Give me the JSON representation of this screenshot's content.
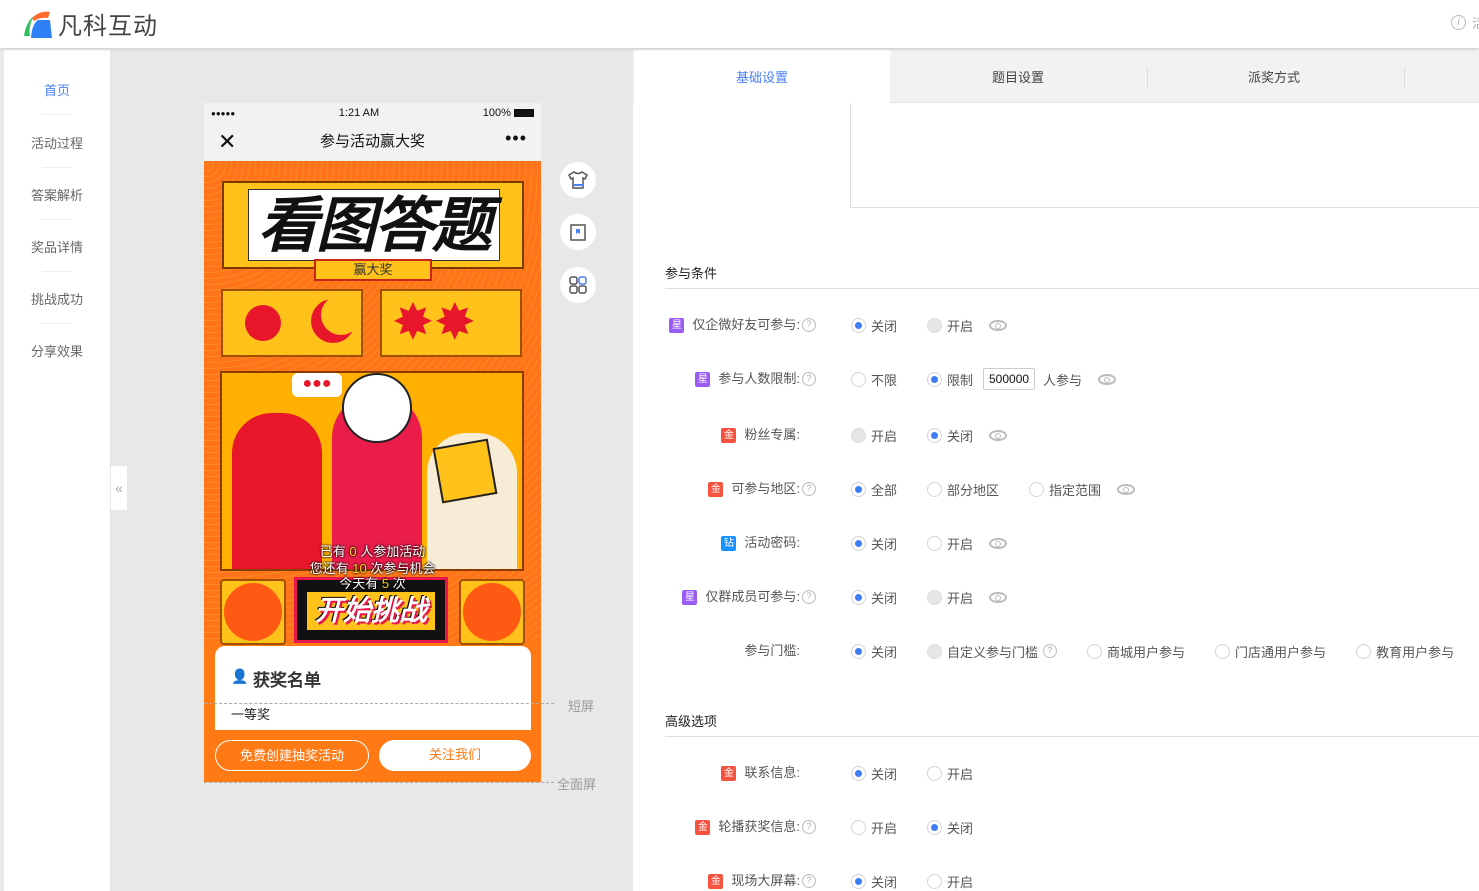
{
  "header": {
    "brand": "凡科互动",
    "right_text": "活"
  },
  "sidebar": {
    "items": [
      {
        "label": "首页",
        "active": true
      },
      {
        "label": "活动过程"
      },
      {
        "label": "答案解析"
      },
      {
        "label": "奖品详情"
      },
      {
        "label": "挑战成功"
      },
      {
        "label": "分享效果"
      }
    ]
  },
  "collapse_label": "«",
  "phone": {
    "status": {
      "signal": "●●●●●",
      "time": "1:21 AM",
      "battery": "100%"
    },
    "nav_title": "参与活动赢大奖",
    "close": "✕",
    "more": "•••",
    "poster_title": "看图答题",
    "poster_ribbon": "赢大奖",
    "stats": {
      "l1a": "已有",
      "l1n": "0",
      "l1b": "人参加活动",
      "l2a": "您还有",
      "l2n": "10",
      "l2b": "次参与机会",
      "l3a": "今天有",
      "l3n": "5",
      "l3b": "次"
    },
    "start_button": "开始挑战",
    "winners_title": "获奖名单",
    "winners_prize": "一等奖",
    "create_button": "免费创建抽奖活动",
    "follow_button": "关注我们"
  },
  "screen_labels": {
    "short": "短屏",
    "full": "全面屏"
  },
  "tabs": [
    {
      "label": "基础设置",
      "active": true
    },
    {
      "label": "题目设置"
    },
    {
      "label": "派奖方式"
    }
  ],
  "sections": {
    "conditions": "参与条件",
    "advanced": "高级选项"
  },
  "badge_colors": {
    "星": "#9b5cf6",
    "金": "#f5533d",
    "钻": "#1890ff"
  },
  "rows": [
    {
      "badge": "星",
      "label": "仅企微好友可参与:",
      "help": true,
      "options": [
        {
          "label": "关闭",
          "state": "on"
        },
        {
          "label": "开启",
          "state": "dis"
        }
      ],
      "eye": true
    },
    {
      "badge": "星",
      "label": "参与人数限制:",
      "help": true,
      "options": [
        {
          "label": "不限",
          "state": "off"
        },
        {
          "label": "限制",
          "state": "on"
        }
      ],
      "input": "500000",
      "suffix": "人参与",
      "eye": true
    },
    {
      "badge": "金",
      "label": "粉丝专属:",
      "help": false,
      "options": [
        {
          "label": "开启",
          "state": "dis"
        },
        {
          "label": "关闭",
          "state": "on"
        }
      ],
      "eye": true
    },
    {
      "badge": "金",
      "label": "可参与地区:",
      "help": true,
      "options": [
        {
          "label": "全部",
          "state": "on"
        },
        {
          "label": "部分地区",
          "state": "off"
        },
        {
          "label": "指定范围",
          "state": "off"
        }
      ],
      "eye": true
    },
    {
      "badge": "钻",
      "label": "活动密码:",
      "help": false,
      "options": [
        {
          "label": "关闭",
          "state": "on"
        },
        {
          "label": "开启",
          "state": "off"
        }
      ],
      "eye": true
    },
    {
      "badge": "星",
      "label": "仅群成员可参与:",
      "help": true,
      "options": [
        {
          "label": "关闭",
          "state": "on"
        },
        {
          "label": "开启",
          "state": "dis"
        }
      ],
      "eye": true
    },
    {
      "badge": "",
      "label": "参与门槛:",
      "help": false,
      "options": [
        {
          "label": "关闭",
          "state": "on"
        },
        {
          "label": "自定义参与门槛",
          "state": "dis",
          "help": true
        },
        {
          "label": "商城用户参与",
          "state": "off"
        },
        {
          "label": "门店通用户参与",
          "state": "off"
        },
        {
          "label": "教育用户参与",
          "state": "off"
        }
      ]
    },
    {
      "badge": "金",
      "label": "联系信息:",
      "help": false,
      "options": [
        {
          "label": "关闭",
          "state": "on"
        },
        {
          "label": "开启",
          "state": "off"
        }
      ]
    },
    {
      "badge": "金",
      "label": "轮播获奖信息:",
      "help": true,
      "options": [
        {
          "label": "开启",
          "state": "off"
        },
        {
          "label": "关闭",
          "state": "on"
        }
      ]
    },
    {
      "badge": "金",
      "label": "现场大屏幕:",
      "help": true,
      "options": [
        {
          "label": "关闭",
          "state": "on"
        },
        {
          "label": "开启",
          "state": "off"
        }
      ]
    }
  ],
  "help_glyph": "?"
}
